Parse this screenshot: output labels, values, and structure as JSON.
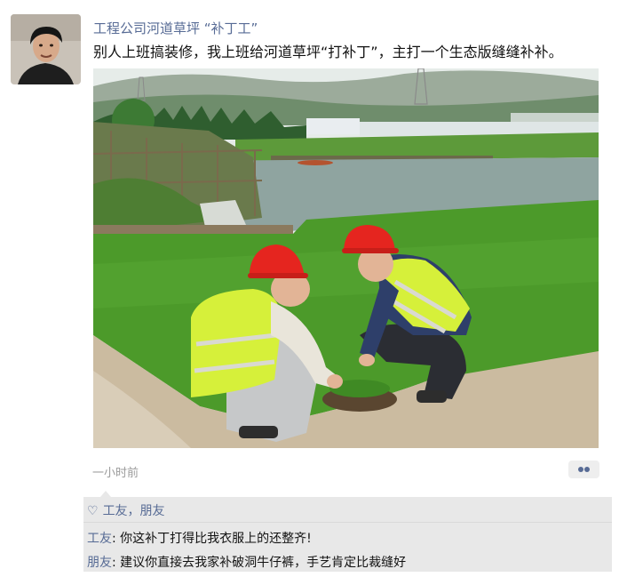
{
  "post": {
    "author": "工程公司河道草坪 “补丁工”",
    "text": "别人上班搞装修，我上班给河道草坪“打补丁”，主打一个生态版缝缝补补。",
    "time": "一小时前",
    "photo_icon": "photo-of-workers-patching-riverside-lawn",
    "avatar_icon": "profile-avatar"
  },
  "interactions": {
    "like_icon": "heart-icon",
    "like_glyph": "♡",
    "likes_text": "工友，朋友",
    "comments": [
      {
        "name": "工友",
        "text": "你这补丁打得比我衣服上的还整齐!"
      },
      {
        "name": "朋友",
        "text": "建议你直接去我家补破洞牛仔裤，手艺肯定比裁缝好"
      }
    ]
  },
  "colors": {
    "link": "#576b95",
    "panel": "#e8e8e8",
    "helmet": "#e5251f",
    "vest": "#d6f03a"
  }
}
